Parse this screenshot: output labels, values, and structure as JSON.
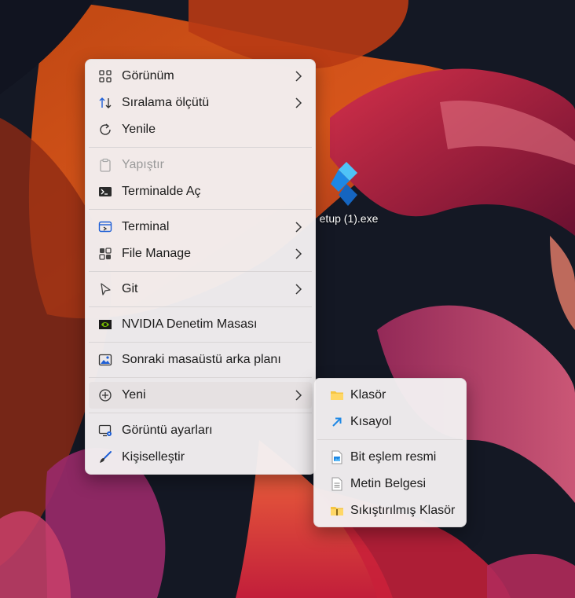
{
  "desktop": {
    "icon_label": "etup (1).exe",
    "icon_name": "app-bolt-icon"
  },
  "context_menu": {
    "items": [
      {
        "label": "Görünüm",
        "icon": "grid-view-icon",
        "submenu": true
      },
      {
        "label": "Sıralama ölçütü",
        "icon": "sort-arrows-icon",
        "submenu": true
      },
      {
        "label": "Yenile",
        "icon": "refresh-icon",
        "submenu": false
      },
      {
        "label": "Yapıştır",
        "icon": "paste-icon",
        "submenu": false,
        "disabled": true
      },
      {
        "label": "Terminalde Aç",
        "icon": "terminal-icon",
        "submenu": false
      },
      {
        "label": "Terminal",
        "icon": "terminal-app-icon",
        "submenu": true
      },
      {
        "label": "File Manage",
        "icon": "apps-icon",
        "submenu": true
      },
      {
        "label": "Git",
        "icon": "git-cursor-icon",
        "submenu": true
      },
      {
        "label": "NVIDIA Denetim Masası",
        "icon": "nvidia-icon",
        "submenu": false
      },
      {
        "label": "Sonraki masaüstü arka planı",
        "icon": "wallpaper-icon",
        "submenu": false
      },
      {
        "label": "Yeni",
        "icon": "plus-circle-icon",
        "submenu": true,
        "highlighted": true
      },
      {
        "label": "Görüntü ayarları",
        "icon": "display-settings-icon",
        "submenu": false
      },
      {
        "label": "Kişiselleştir",
        "icon": "brush-icon",
        "submenu": false
      }
    ]
  },
  "new_submenu": {
    "items": [
      {
        "label": "Klasör",
        "icon": "folder-icon"
      },
      {
        "label": "Kısayol",
        "icon": "shortcut-arrow-icon"
      },
      {
        "label": "Bit eşlem resmi",
        "icon": "bitmap-icon"
      },
      {
        "label": "Metin Belgesi",
        "icon": "text-document-icon"
      },
      {
        "label": "Sıkıştırılmış Klasör",
        "icon": "zip-folder-icon"
      }
    ]
  },
  "colors": {
    "menu_bg": "#f3f0f1",
    "highlight": "#e6e1e2",
    "text": "#1b1b1b",
    "disabled_text": "#9a9a9a",
    "folder_yellow": "#f5c542",
    "accent_blue": "#1e88e5"
  }
}
